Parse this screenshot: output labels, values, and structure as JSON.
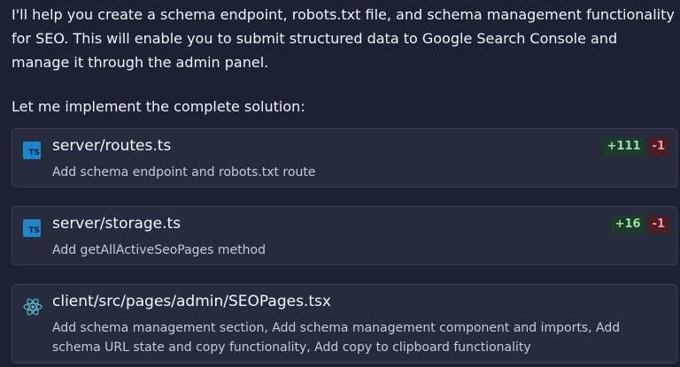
{
  "intro_text": "I'll help you create a schema endpoint, robots.txt file, and schema management functionality for SEO. This will enable you to submit structured data to Google Search Console and manage it through the admin panel.",
  "lead_text": "Let me implement the complete solution:",
  "changes": [
    {
      "icon": "typescript-file-icon",
      "title": "server/routes.ts",
      "description": "Add schema endpoint and robots.txt route",
      "additions": "+111",
      "deletions": "-1"
    },
    {
      "icon": "typescript-file-icon",
      "title": "server/storage.ts",
      "description": "Add getAllActiveSeoPages method",
      "additions": "+16",
      "deletions": "-1"
    },
    {
      "icon": "react-file-icon",
      "title": "client/src/pages/admin/SEOPages.tsx",
      "description": "Add schema management section, Add schema management component and imports, Add schema URL state and copy functionality, Add copy to clipboard functionality"
    }
  ],
  "colors": {
    "background": "#1c2232",
    "card_background": "#262c3e",
    "card_border": "#394158",
    "typescript_icon": "#1f86c9",
    "react_icon": "#58c4dc",
    "additions_text": "#9be0a4",
    "additions_background": "#1d3a2a",
    "deletions_text": "#f29aa0",
    "deletions_background": "#4d1d24"
  }
}
